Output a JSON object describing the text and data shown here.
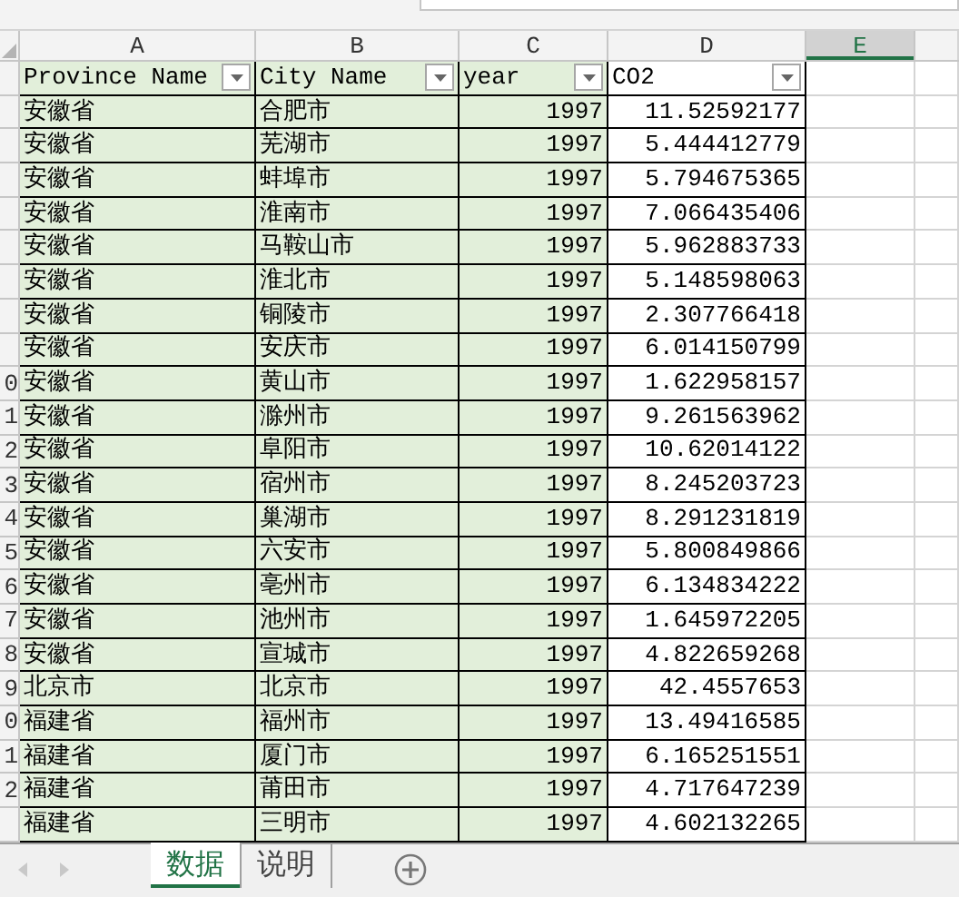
{
  "columns": [
    {
      "letter": "A",
      "selected": false
    },
    {
      "letter": "B",
      "selected": false
    },
    {
      "letter": "C",
      "selected": false
    },
    {
      "letter": "D",
      "selected": false
    },
    {
      "letter": "E",
      "selected": true
    }
  ],
  "header_row": [
    {
      "label": "Province Name",
      "filter": true
    },
    {
      "label": "City Name",
      "filter": true
    },
    {
      "label": "year",
      "filter": true
    },
    {
      "label": "CO2",
      "filter": true
    }
  ],
  "rows": [
    {
      "province": "安徽省",
      "city": "合肥市",
      "year": "1997",
      "co2": "11.52592177"
    },
    {
      "province": "安徽省",
      "city": "芜湖市",
      "year": "1997",
      "co2": "5.444412779"
    },
    {
      "province": "安徽省",
      "city": "蚌埠市",
      "year": "1997",
      "co2": "5.794675365"
    },
    {
      "province": "安徽省",
      "city": "淮南市",
      "year": "1997",
      "co2": "7.066435406"
    },
    {
      "province": "安徽省",
      "city": "马鞍山市",
      "year": "1997",
      "co2": "5.962883733"
    },
    {
      "province": "安徽省",
      "city": "淮北市",
      "year": "1997",
      "co2": "5.148598063"
    },
    {
      "province": "安徽省",
      "city": "铜陵市",
      "year": "1997",
      "co2": "2.307766418"
    },
    {
      "province": "安徽省",
      "city": "安庆市",
      "year": "1997",
      "co2": "6.014150799"
    },
    {
      "row_number": "0",
      "province": "安徽省",
      "city": "黄山市",
      "year": "1997",
      "co2": "1.622958157"
    },
    {
      "row_number": "1",
      "province": "安徽省",
      "city": "滁州市",
      "year": "1997",
      "co2": "9.261563962"
    },
    {
      "row_number": "2",
      "province": "安徽省",
      "city": "阜阳市",
      "year": "1997",
      "co2": "10.62014122"
    },
    {
      "row_number": "3",
      "province": "安徽省",
      "city": "宿州市",
      "year": "1997",
      "co2": "8.245203723"
    },
    {
      "row_number": "4",
      "province": "安徽省",
      "city": "巢湖市",
      "year": "1997",
      "co2": "8.291231819"
    },
    {
      "row_number": "5",
      "province": "安徽省",
      "city": "六安市",
      "year": "1997",
      "co2": "5.800849866"
    },
    {
      "row_number": "6",
      "province": "安徽省",
      "city": "亳州市",
      "year": "1997",
      "co2": "6.134834222"
    },
    {
      "row_number": "7",
      "province": "安徽省",
      "city": "池州市",
      "year": "1997",
      "co2": "1.645972205"
    },
    {
      "row_number": "8",
      "province": "安徽省",
      "city": "宣城市",
      "year": "1997",
      "co2": "4.822659268"
    },
    {
      "row_number": "9",
      "province": "北京市",
      "city": "北京市",
      "year": "1997",
      "co2": "42.4557653"
    },
    {
      "row_number": "0",
      "province": "福建省",
      "city": "福州市",
      "year": "1997",
      "co2": "13.49416585"
    },
    {
      "row_number": "1",
      "province": "福建省",
      "city": "厦门市",
      "year": "1997",
      "co2": "6.165251551"
    },
    {
      "row_number": "2",
      "province": "福建省",
      "city": "莆田市",
      "year": "1997",
      "co2": "4.717647239"
    },
    {
      "province": "福建省",
      "city": "三明市",
      "year": "1997",
      "co2": "4.602132265"
    }
  ],
  "sheet_tabs": [
    {
      "label": "数据",
      "selected": true
    },
    {
      "label": "说明",
      "selected": false
    }
  ]
}
